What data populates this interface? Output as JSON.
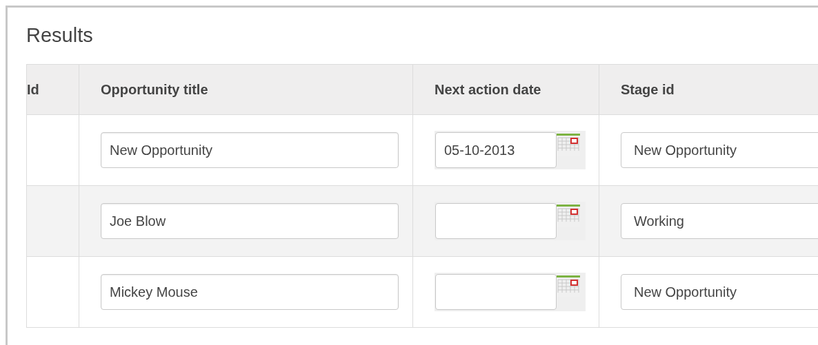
{
  "title": "Results",
  "table": {
    "columns": [
      "Id",
      "Opportunity title",
      "Next action date",
      "Stage id"
    ],
    "rows": [
      {
        "id": "",
        "title": "New Opportunity",
        "date": "05-10-2013",
        "stage": "New Opportunity"
      },
      {
        "id": "",
        "title": "Joe Blow",
        "date": "",
        "stage": "Working"
      },
      {
        "id": "",
        "title": "Mickey Mouse",
        "date": "",
        "stage": "New Opportunity"
      }
    ]
  }
}
